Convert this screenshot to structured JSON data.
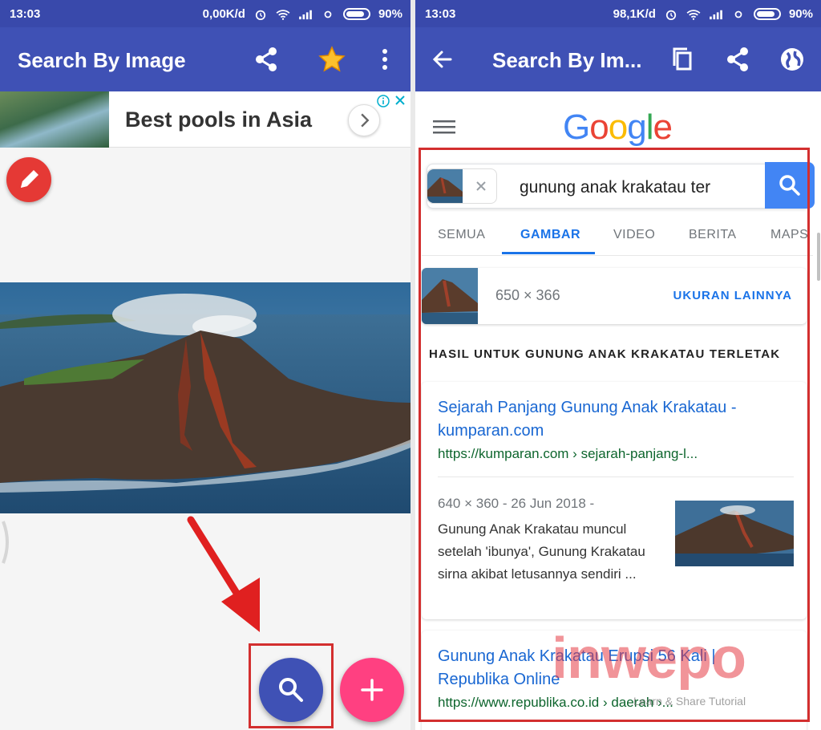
{
  "left_screen": {
    "status": {
      "time": "13:03",
      "speed": "0,00K/d",
      "battery": "90%"
    },
    "appbar": {
      "title": "Search By Image"
    },
    "ad": {
      "title": "Best pools in Asia"
    }
  },
  "right_screen": {
    "status": {
      "time": "13:03",
      "speed": "98,1K/d",
      "battery": "90%"
    },
    "appbar": {
      "title": "Search By Im..."
    },
    "google": {
      "logo": [
        "G",
        "o",
        "o",
        "g",
        "l",
        "e"
      ],
      "logo_colors": [
        "#4285F4",
        "#EA4335",
        "#FBBC05",
        "#4285F4",
        "#34A853",
        "#EA4335"
      ],
      "query": "gunung anak krakatau ter",
      "tabs": [
        {
          "label": "SEMUA",
          "active": false
        },
        {
          "label": "GAMBAR",
          "active": true
        },
        {
          "label": "VIDEO",
          "active": false
        },
        {
          "label": "BERITA",
          "active": false
        },
        {
          "label": "MAPS",
          "active": false
        }
      ],
      "image_size": "650 × 366",
      "more_sizes": "UKURAN LAINNYA",
      "results_heading": "HASIL UNTUK GUNUNG ANAK KRAKATAU TERLETAK",
      "results": [
        {
          "title": "Sejarah Panjang Gunung Anak Krakatau - kumparan.com",
          "url": "https://kumparan.com › sejarah-panjang-l...",
          "meta": "640 × 360 - 26 Jun 2018 -",
          "snippet": "Gunung Anak Krakatau muncul setelah 'ibunya', Gunung Krakatau sirna akibat letusannya sendiri ..."
        },
        {
          "title": "Gunung Anak Krakatau Erupsi 56 Kali | Republika Online",
          "url": "https://www.republika.co.id › daerah ›..."
        }
      ]
    }
  },
  "watermark": {
    "brand": "inwepo",
    "tagline": "Learn & Share Tutorial"
  },
  "colors": {
    "appbar": "#3f51b5",
    "statusbar": "#3949ab",
    "accent_pink": "#ff4081",
    "edit_red": "#e53935",
    "highlight_red": "#d32f2f",
    "google_blue": "#4285f4"
  }
}
